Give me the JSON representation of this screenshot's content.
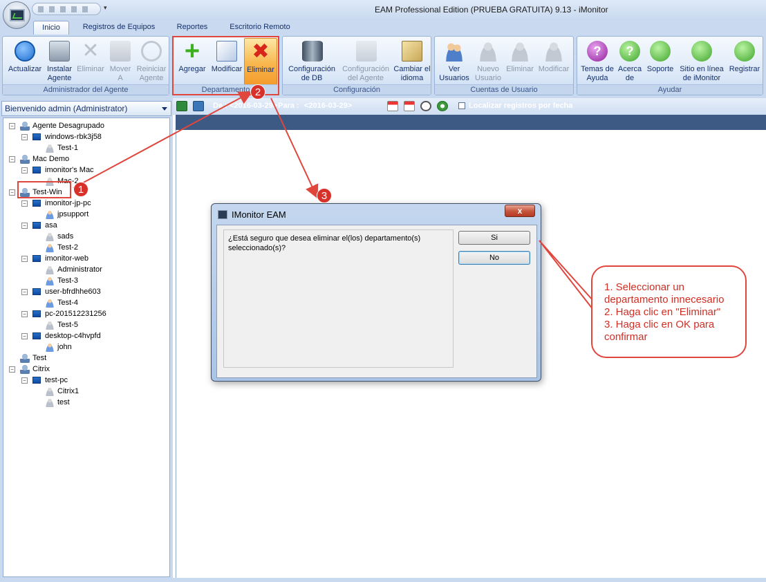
{
  "window": {
    "title": "EAM Professional Edition (PRUEBA GRATUITA) 9.13 - iMonitor",
    "qat_dropdown": "▾"
  },
  "tabs": [
    "Inicio",
    "Registros de Equipos",
    "Reportes",
    "Escritorio Remoto"
  ],
  "ribbon": {
    "groups": [
      {
        "label": "Administrador del Agente",
        "buttons": [
          "Actualizar",
          "Instalar Agente",
          "Eliminar",
          "Mover A",
          "Reiniciar Agente"
        ]
      },
      {
        "label": "Departamento",
        "buttons": [
          "Agregar",
          "Modificar",
          "Eliminar"
        ]
      },
      {
        "label": "Configuración",
        "buttons": [
          "Configuración de DB",
          "Configuración del Agente",
          "Cambiar el idioma"
        ]
      },
      {
        "label": "Cuentas de Usuario",
        "buttons": [
          "Ver Usuarios",
          "Nuevo Usuario",
          "Eliminar",
          "Modificar"
        ]
      },
      {
        "label": "Ayudar",
        "buttons": [
          "Temas de Ayuda",
          "Acerca de",
          "Soporte",
          "Sitio en línea de iMonitor",
          "Registrar"
        ]
      }
    ]
  },
  "left_panel": {
    "header": "Bienvenido admin (Administrator)",
    "tree": [
      {
        "label": "Agente Desagrupado",
        "type": "group"
      },
      {
        "label": "windows-rbk3j58",
        "type": "pc"
      },
      {
        "label": "Test-1",
        "type": "user-offline"
      },
      {
        "label": "Mac Demo",
        "type": "group"
      },
      {
        "label": "imonitor's Mac",
        "type": "pc"
      },
      {
        "label": "Mac-2",
        "type": "user-offline"
      },
      {
        "label": "Test-Win",
        "type": "group"
      },
      {
        "label": "imonitor-jp-pc",
        "type": "pc"
      },
      {
        "label": "jpsupport",
        "type": "user-online"
      },
      {
        "label": "asa",
        "type": "pc"
      },
      {
        "label": "sads",
        "type": "user-offline"
      },
      {
        "label": "Test-2",
        "type": "user-online"
      },
      {
        "label": "imonitor-web",
        "type": "pc"
      },
      {
        "label": "Administrator",
        "type": "user-offline"
      },
      {
        "label": "Test-3",
        "type": "user-online"
      },
      {
        "label": "user-bfrdhhe603",
        "type": "pc"
      },
      {
        "label": "Test-4",
        "type": "user-online"
      },
      {
        "label": "pc-201512231256",
        "type": "pc"
      },
      {
        "label": "Test-5",
        "type": "user-offline"
      },
      {
        "label": "desktop-c4hvpfd",
        "type": "pc"
      },
      {
        "label": "john",
        "type": "user-online"
      },
      {
        "label": "Test",
        "type": "group"
      },
      {
        "label": "Citrix",
        "type": "group"
      },
      {
        "label": "test-pc",
        "type": "pc"
      },
      {
        "label": "Citrix1",
        "type": "user-offline"
      },
      {
        "label": "test",
        "type": "user-offline"
      }
    ]
  },
  "toolbar": {
    "date_range_de": "De :",
    "date_from": "<2016-03-29>",
    "date_para": "Para :",
    "date_to": "<2016-03-29>",
    "locate_label": "Localizar registros por fecha"
  },
  "dialog": {
    "title": "IMonitor EAM",
    "message": "¿Está seguro que desea eliminar el(los) departamento(s) seleccionado(s)?",
    "yes_label": "Si",
    "no_label": "No",
    "close_label": "x"
  },
  "annotations": {
    "badges": [
      "1",
      "2",
      "3"
    ],
    "callout_lines": [
      "1. Seleccionar un departamento innecesario",
      "2. Haga clic en \"Eliminar\"",
      "3. Haga clic en OK para confirmar"
    ],
    "color": "#e0463c"
  }
}
